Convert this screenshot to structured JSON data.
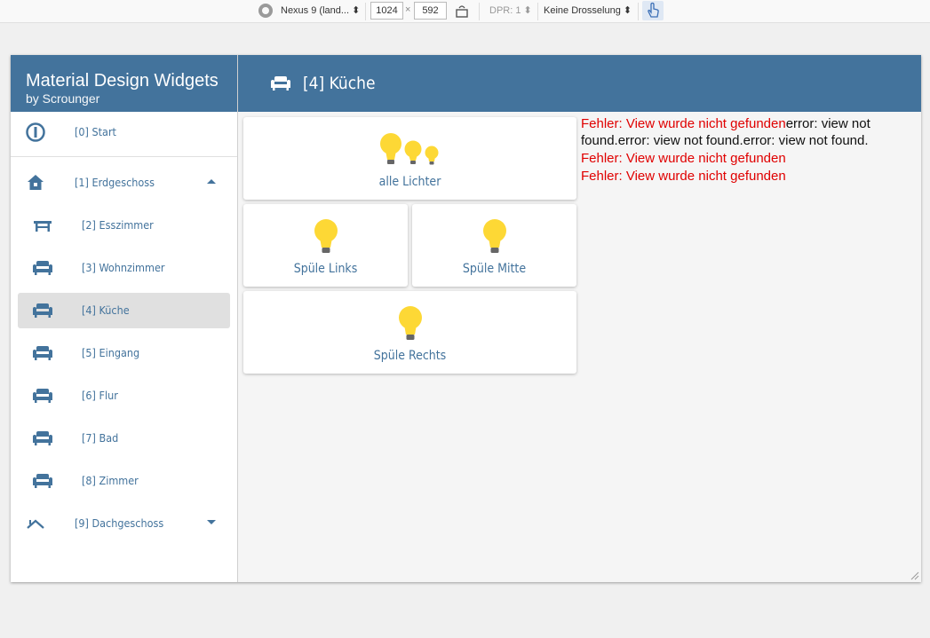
{
  "devtools": {
    "device": "Nexus 9 (land...",
    "width": "1024",
    "height": "592",
    "times": "×",
    "dpr": "DPR: 1",
    "throttle": "Keine Drosselung"
  },
  "sidebar": {
    "title": "Material Design Widgets",
    "subtitle": "by Scrounger",
    "items": [
      {
        "label": "[0] Start",
        "icon": "info-icon"
      },
      {
        "label": "[1] Erdgeschoss",
        "icon": "house-icon"
      },
      {
        "label": "[2] Esszimmer",
        "icon": "table-icon"
      },
      {
        "label": "[3] Wohnzimmer",
        "icon": "sofa-icon"
      },
      {
        "label": "[4] Küche",
        "icon": "sofa-icon"
      },
      {
        "label": "[5] Eingang",
        "icon": "sofa-icon"
      },
      {
        "label": "[6] Flur",
        "icon": "sofa-icon"
      },
      {
        "label": "[7] Bad",
        "icon": "sofa-icon"
      },
      {
        "label": "[8] Zimmer",
        "icon": "sofa-icon"
      },
      {
        "label": "[9] Dachgeschoss",
        "icon": "roof-icon"
      }
    ]
  },
  "header": {
    "title": "[4] Küche",
    "icon": "sofa-icon"
  },
  "cards": [
    {
      "label": "alle Lichter",
      "icon": "bulbs-icon"
    },
    {
      "label": "Spüle Links",
      "icon": "bulb-icon"
    },
    {
      "label": "Spüle Mitte",
      "icon": "bulb-icon"
    },
    {
      "label": "Spüle Rechts",
      "icon": "bulb-icon"
    }
  ],
  "errors": {
    "line1_red": "Fehler: View wurde nicht gefunden",
    "line1_black": "error: view not found.error: view not found.error: view not found.",
    "line2": "Fehler: View wurde nicht gefunden",
    "line3": "Fehler: View wurde nicht gefunden"
  },
  "colors": {
    "accent": "#43739c",
    "bulb": "#fdd835",
    "error": "#e00000",
    "selected": "#e0e0e0"
  }
}
